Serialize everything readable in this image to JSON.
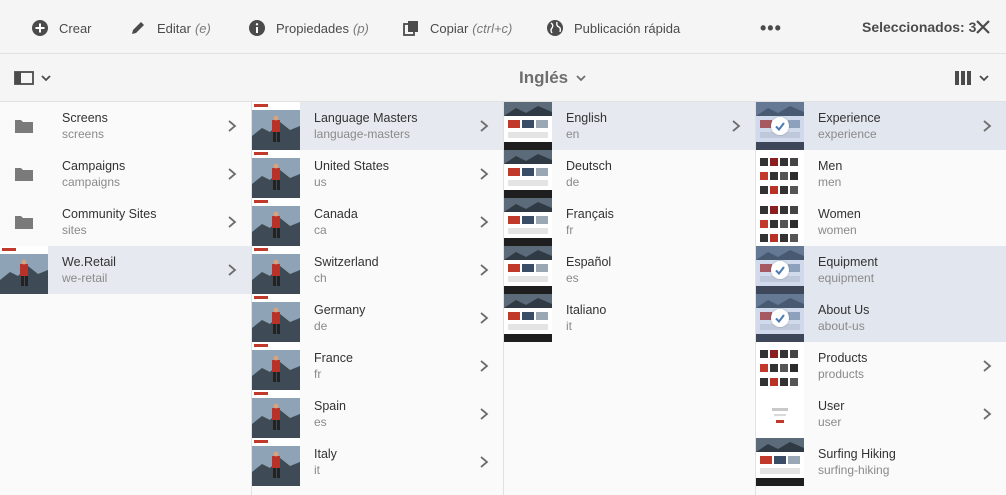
{
  "actionbar": {
    "create_label": "Crear",
    "edit_label": "Editar",
    "edit_shortcut": "(e)",
    "properties_label": "Propiedades",
    "properties_shortcut": "(p)",
    "copy_label": "Copiar",
    "copy_shortcut": "(ctrl+c)",
    "publish_label": "Publicación rápida",
    "more_label": "•••",
    "selected_text": "Seleccionados: 3"
  },
  "titlebar": {
    "title": "Inglés"
  },
  "columns": [
    {
      "items": [
        {
          "title": "Screens",
          "name": "screens",
          "thumb": "folder",
          "chevron": true,
          "state": ""
        },
        {
          "title": "Campaigns",
          "name": "campaigns",
          "thumb": "folder",
          "chevron": true,
          "state": ""
        },
        {
          "title": "Community Sites",
          "name": "sites",
          "thumb": "folder",
          "chevron": true,
          "state": ""
        },
        {
          "title": "We.Retail",
          "name": "we-retail",
          "thumb": "hiker",
          "chevron": true,
          "state": "active"
        }
      ]
    },
    {
      "items": [
        {
          "title": "Language Masters",
          "name": "language-masters",
          "thumb": "hiker",
          "chevron": true,
          "state": "active"
        },
        {
          "title": "United States",
          "name": "us",
          "thumb": "hiker",
          "chevron": true,
          "state": ""
        },
        {
          "title": "Canada",
          "name": "ca",
          "thumb": "hiker",
          "chevron": true,
          "state": ""
        },
        {
          "title": "Switzerland",
          "name": "ch",
          "thumb": "hiker",
          "chevron": true,
          "state": ""
        },
        {
          "title": "Germany",
          "name": "de",
          "thumb": "hiker",
          "chevron": true,
          "state": ""
        },
        {
          "title": "France",
          "name": "fr",
          "thumb": "hiker",
          "chevron": true,
          "state": ""
        },
        {
          "title": "Spain",
          "name": "es",
          "thumb": "hiker",
          "chevron": true,
          "state": ""
        },
        {
          "title": "Italy",
          "name": "it",
          "thumb": "hiker",
          "chevron": true,
          "state": ""
        }
      ]
    },
    {
      "items": [
        {
          "title": "English",
          "name": "en",
          "thumb": "page",
          "chevron": true,
          "state": "active"
        },
        {
          "title": "Deutsch",
          "name": "de",
          "thumb": "page",
          "chevron": false,
          "state": ""
        },
        {
          "title": "Français",
          "name": "fr",
          "thumb": "page",
          "chevron": false,
          "state": ""
        },
        {
          "title": "Español",
          "name": "es",
          "thumb": "page",
          "chevron": false,
          "state": ""
        },
        {
          "title": "Italiano",
          "name": "it",
          "thumb": "page",
          "chevron": false,
          "state": ""
        }
      ]
    },
    {
      "items": [
        {
          "title": "Experience",
          "name": "experience",
          "thumb": "page",
          "chevron": true,
          "state": "selected"
        },
        {
          "title": "Men",
          "name": "men",
          "thumb": "products",
          "chevron": false,
          "state": ""
        },
        {
          "title": "Women",
          "name": "women",
          "thumb": "products",
          "chevron": false,
          "state": ""
        },
        {
          "title": "Equipment",
          "name": "equipment",
          "thumb": "page",
          "chevron": false,
          "state": "selected"
        },
        {
          "title": "About Us",
          "name": "about-us",
          "thumb": "page",
          "chevron": false,
          "state": "selected"
        },
        {
          "title": "Products",
          "name": "products",
          "thumb": "products",
          "chevron": true,
          "state": ""
        },
        {
          "title": "User",
          "name": "user",
          "thumb": "blank",
          "chevron": true,
          "state": ""
        },
        {
          "title": "Surfing Hiking",
          "name": "surfing-hiking",
          "thumb": "page",
          "chevron": false,
          "state": ""
        }
      ]
    }
  ]
}
